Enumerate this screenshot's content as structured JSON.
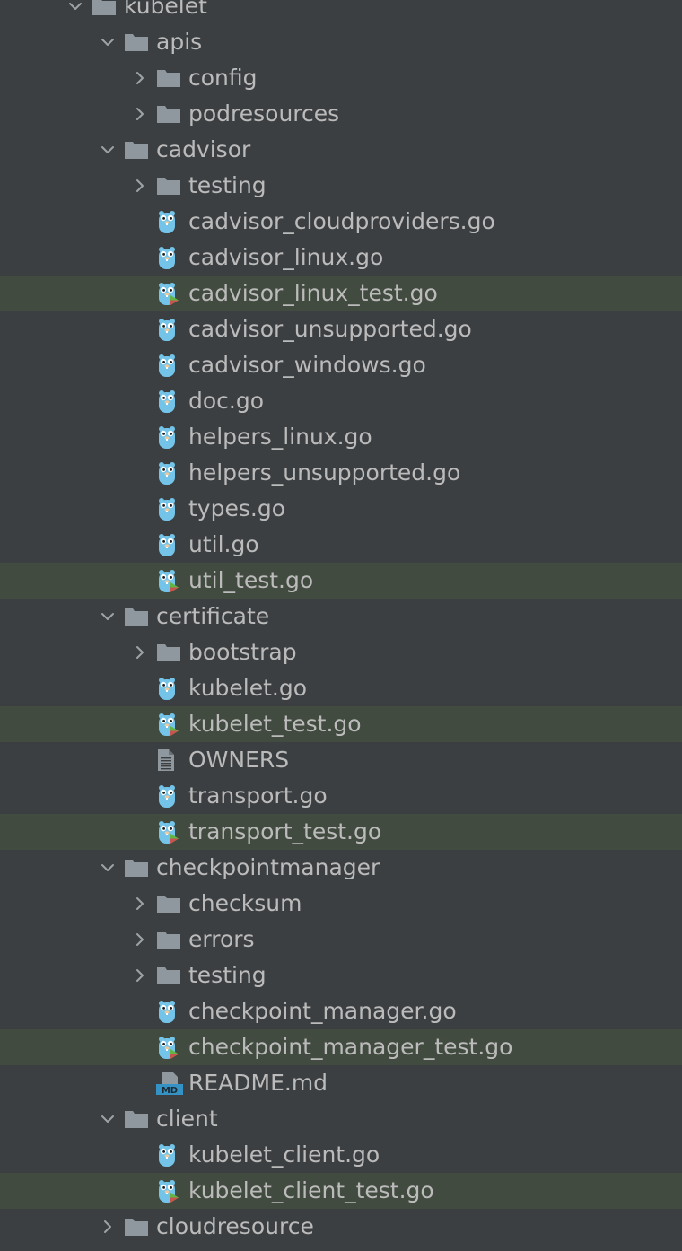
{
  "tree": {
    "rows": [
      {
        "label": "kubelet",
        "type": "folder",
        "expanded": true,
        "depth": 0,
        "icon": "folder-icon"
      },
      {
        "label": "apis",
        "type": "folder",
        "expanded": true,
        "depth": 1,
        "icon": "folder-icon"
      },
      {
        "label": "config",
        "type": "folder",
        "expanded": false,
        "depth": 2,
        "icon": "folder-icon"
      },
      {
        "label": "podresources",
        "type": "folder",
        "expanded": false,
        "depth": 2,
        "icon": "folder-icon"
      },
      {
        "label": "cadvisor",
        "type": "folder",
        "expanded": true,
        "depth": 1,
        "icon": "folder-icon"
      },
      {
        "label": "testing",
        "type": "folder",
        "expanded": false,
        "depth": 2,
        "icon": "folder-icon"
      },
      {
        "label": "cadvisor_cloudproviders.go",
        "type": "go",
        "depth": 2,
        "icon": "go-file-icon"
      },
      {
        "label": "cadvisor_linux.go",
        "type": "go",
        "depth": 2,
        "icon": "go-file-icon"
      },
      {
        "label": "cadvisor_linux_test.go",
        "type": "gotest",
        "depth": 2,
        "icon": "go-test-file-icon",
        "highlighted": true
      },
      {
        "label": "cadvisor_unsupported.go",
        "type": "go",
        "depth": 2,
        "icon": "go-file-icon"
      },
      {
        "label": "cadvisor_windows.go",
        "type": "go",
        "depth": 2,
        "icon": "go-file-icon"
      },
      {
        "label": "doc.go",
        "type": "go",
        "depth": 2,
        "icon": "go-file-icon"
      },
      {
        "label": "helpers_linux.go",
        "type": "go",
        "depth": 2,
        "icon": "go-file-icon"
      },
      {
        "label": "helpers_unsupported.go",
        "type": "go",
        "depth": 2,
        "icon": "go-file-icon"
      },
      {
        "label": "types.go",
        "type": "go",
        "depth": 2,
        "icon": "go-file-icon"
      },
      {
        "label": "util.go",
        "type": "go",
        "depth": 2,
        "icon": "go-file-icon"
      },
      {
        "label": "util_test.go",
        "type": "gotest",
        "depth": 2,
        "icon": "go-test-file-icon",
        "highlighted": true
      },
      {
        "label": "certificate",
        "type": "folder",
        "expanded": true,
        "depth": 1,
        "icon": "folder-icon"
      },
      {
        "label": "bootstrap",
        "type": "folder",
        "expanded": false,
        "depth": 2,
        "icon": "folder-icon"
      },
      {
        "label": "kubelet.go",
        "type": "go",
        "depth": 2,
        "icon": "go-file-icon"
      },
      {
        "label": "kubelet_test.go",
        "type": "gotest",
        "depth": 2,
        "icon": "go-test-file-icon",
        "highlighted": true
      },
      {
        "label": "OWNERS",
        "type": "text",
        "depth": 2,
        "icon": "text-file-icon"
      },
      {
        "label": "transport.go",
        "type": "go",
        "depth": 2,
        "icon": "go-file-icon"
      },
      {
        "label": "transport_test.go",
        "type": "gotest",
        "depth": 2,
        "icon": "go-test-file-icon",
        "highlighted": true
      },
      {
        "label": "checkpointmanager",
        "type": "folder",
        "expanded": true,
        "depth": 1,
        "icon": "folder-icon"
      },
      {
        "label": "checksum",
        "type": "folder",
        "expanded": false,
        "depth": 2,
        "icon": "folder-icon"
      },
      {
        "label": "errors",
        "type": "folder",
        "expanded": false,
        "depth": 2,
        "icon": "folder-icon"
      },
      {
        "label": "testing",
        "type": "folder",
        "expanded": false,
        "depth": 2,
        "icon": "folder-icon"
      },
      {
        "label": "checkpoint_manager.go",
        "type": "go",
        "depth": 2,
        "icon": "go-file-icon"
      },
      {
        "label": "checkpoint_manager_test.go",
        "type": "gotest",
        "depth": 2,
        "icon": "go-test-file-icon",
        "highlighted": true
      },
      {
        "label": "README.md",
        "type": "md",
        "depth": 2,
        "icon": "markdown-file-icon"
      },
      {
        "label": "client",
        "type": "folder",
        "expanded": true,
        "depth": 1,
        "icon": "folder-icon"
      },
      {
        "label": "kubelet_client.go",
        "type": "go",
        "depth": 2,
        "icon": "go-file-icon"
      },
      {
        "label": "kubelet_client_test.go",
        "type": "gotest",
        "depth": 2,
        "icon": "go-test-file-icon",
        "highlighted": true
      },
      {
        "label": "cloudresource",
        "type": "folder",
        "expanded": false,
        "depth": 1,
        "icon": "folder-icon"
      }
    ]
  },
  "colors": {
    "background": "#3c3f41",
    "highlight_row": "#424b3f",
    "text": "#bbbbbb",
    "folder": "#8f989e",
    "gopher": "#73c4e8",
    "test_marker": "#62b543",
    "test_marker_red": "#c75450",
    "markdown_badge": "#3592c4"
  }
}
